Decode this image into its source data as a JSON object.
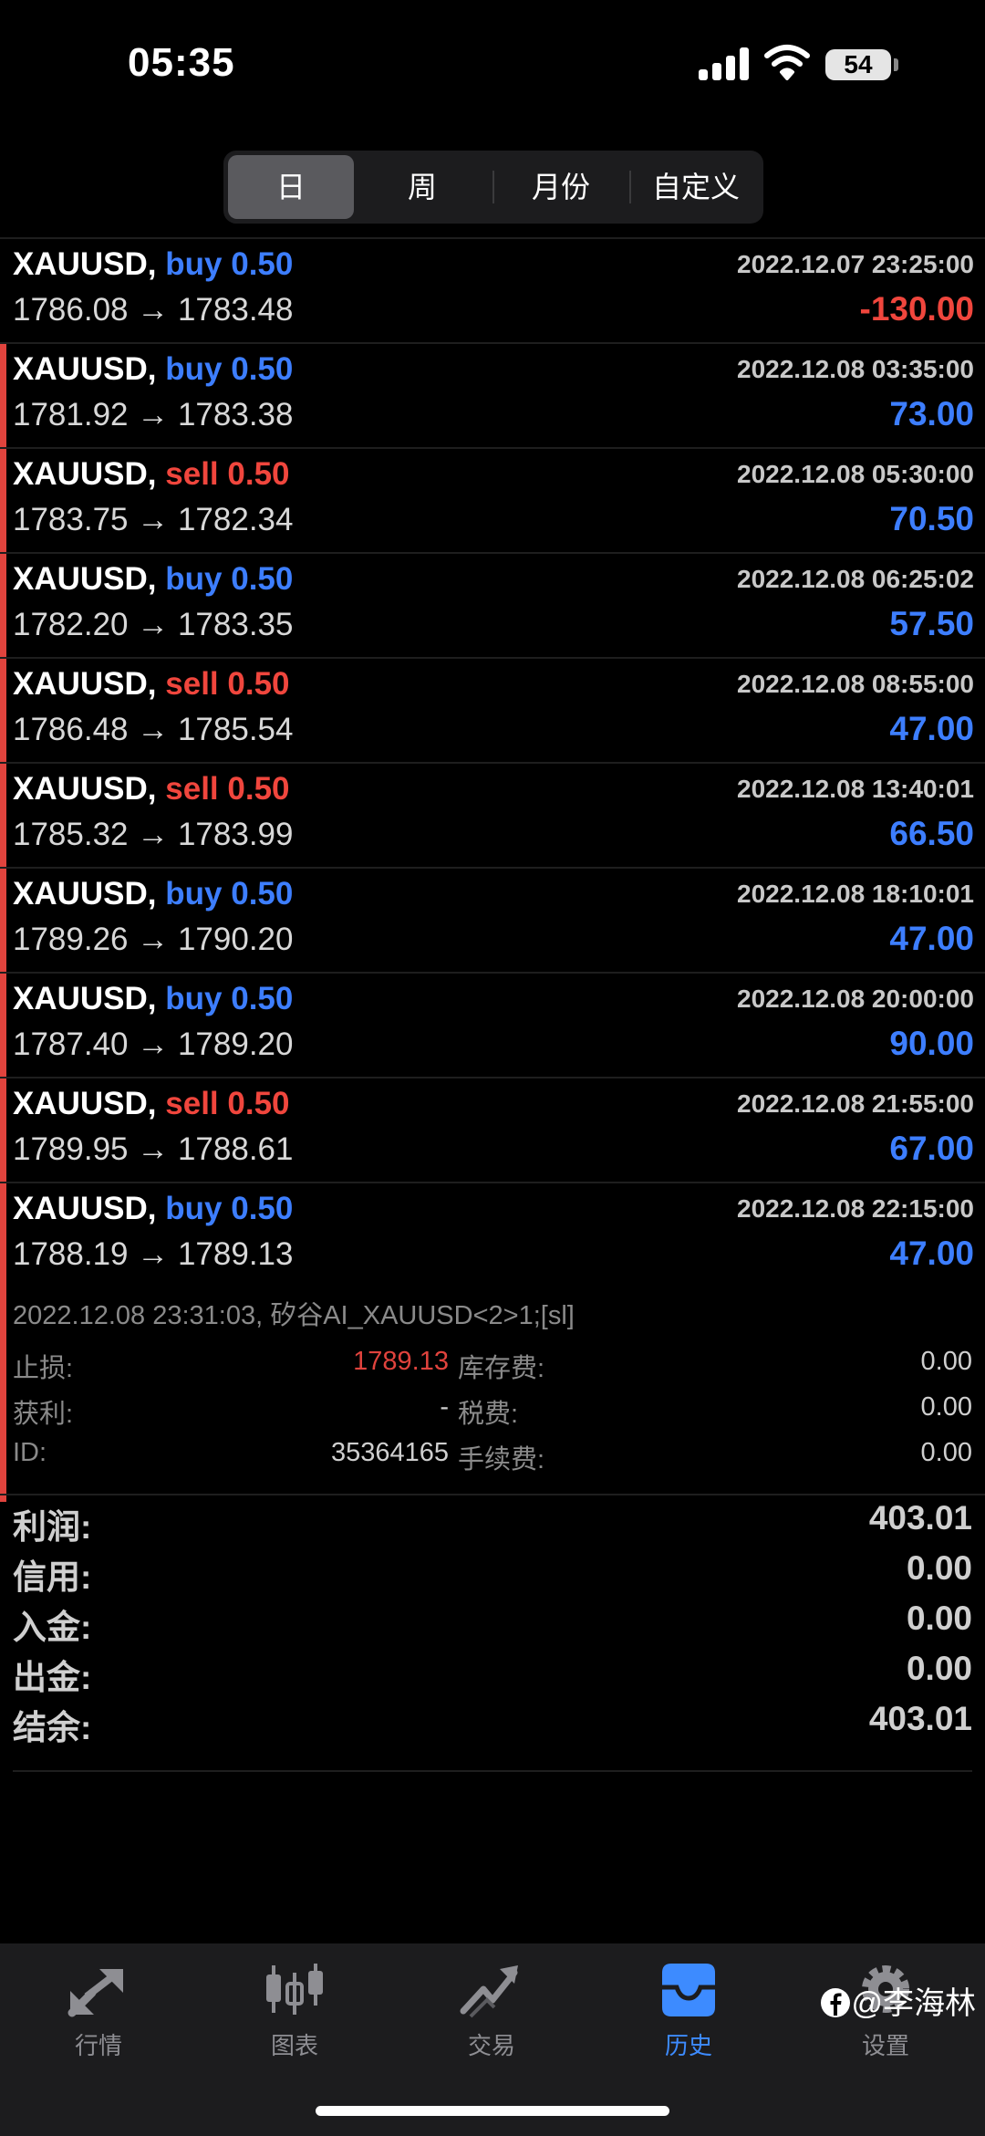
{
  "status": {
    "time": "05:35",
    "battery": "54"
  },
  "segments": {
    "day": "日",
    "week": "周",
    "month": "月份",
    "custom": "自定义"
  },
  "deals": [
    {
      "symbol": "XAUUSD,",
      "direction": "buy",
      "volume": "0.50",
      "prices": "1786.08 → 1783.48",
      "time": "2022.12.07 23:25:00",
      "profit": "-130.00"
    },
    {
      "symbol": "XAUUSD,",
      "direction": "buy",
      "volume": "0.50",
      "prices": "1781.92 → 1783.38",
      "time": "2022.12.08 03:35:00",
      "profit": "73.00"
    },
    {
      "symbol": "XAUUSD,",
      "direction": "sell",
      "volume": "0.50",
      "prices": "1783.75 → 1782.34",
      "time": "2022.12.08 05:30:00",
      "profit": "70.50"
    },
    {
      "symbol": "XAUUSD,",
      "direction": "buy",
      "volume": "0.50",
      "prices": "1782.20 → 1783.35",
      "time": "2022.12.08 06:25:02",
      "profit": "57.50"
    },
    {
      "symbol": "XAUUSD,",
      "direction": "sell",
      "volume": "0.50",
      "prices": "1786.48 → 1785.54",
      "time": "2022.12.08 08:55:00",
      "profit": "47.00"
    },
    {
      "symbol": "XAUUSD,",
      "direction": "sell",
      "volume": "0.50",
      "prices": "1785.32 → 1783.99",
      "time": "2022.12.08 13:40:01",
      "profit": "66.50"
    },
    {
      "symbol": "XAUUSD,",
      "direction": "buy",
      "volume": "0.50",
      "prices": "1789.26 → 1790.20",
      "time": "2022.12.08 18:10:01",
      "profit": "47.00"
    },
    {
      "symbol": "XAUUSD,",
      "direction": "buy",
      "volume": "0.50",
      "prices": "1787.40 → 1789.20",
      "time": "2022.12.08 20:00:00",
      "profit": "90.00"
    },
    {
      "symbol": "XAUUSD,",
      "direction": "sell",
      "volume": "0.50",
      "prices": "1789.95 → 1788.61",
      "time": "2022.12.08 21:55:00",
      "profit": "67.00"
    },
    {
      "symbol": "XAUUSD,",
      "direction": "buy",
      "volume": "0.50",
      "prices": "1788.19 → 1789.13",
      "time": "2022.12.08 22:15:00",
      "profit": "47.00"
    }
  ],
  "detail": {
    "comment": "2022.12.08 23:31:03, 矽谷AI_XAUUSD<2>1;[sl]",
    "sl_label": "止损:",
    "sl_value": "1789.13",
    "tp_label": "获利:",
    "tp_value": "-",
    "id_label": "ID:",
    "id_value": "35364165",
    "swap_label": "库存费:",
    "swap_value": "0.00",
    "tax_label": "税费:",
    "tax_value": "0.00",
    "commission_label": "手续费:",
    "commission_value": "0.00"
  },
  "summary": {
    "profit_label": "利润:",
    "profit_value": "403.01",
    "credit_label": "信用:",
    "credit_value": "0.00",
    "deposit_label": "入金:",
    "deposit_value": "0.00",
    "withdrawal_label": "出金:",
    "withdrawal_value": "0.00",
    "balance_label": "结余:",
    "balance_value": "403.01"
  },
  "tabs": {
    "quotes": "行情",
    "chart": "图表",
    "trade": "交易",
    "history": "历史",
    "settings": "设置"
  },
  "watermark": "@李海林",
  "colors": {
    "buy": "#3d7eff",
    "sell": "#f0463d",
    "active_tab": "#3d8bff"
  },
  "icons": [
    "signal-icon",
    "wifi-icon",
    "battery-icon",
    "quotes-arrows-icon",
    "candlestick-chart-icon",
    "trade-line-icon",
    "history-inbox-icon",
    "settings-gear-icon",
    "facebook-icon"
  ]
}
